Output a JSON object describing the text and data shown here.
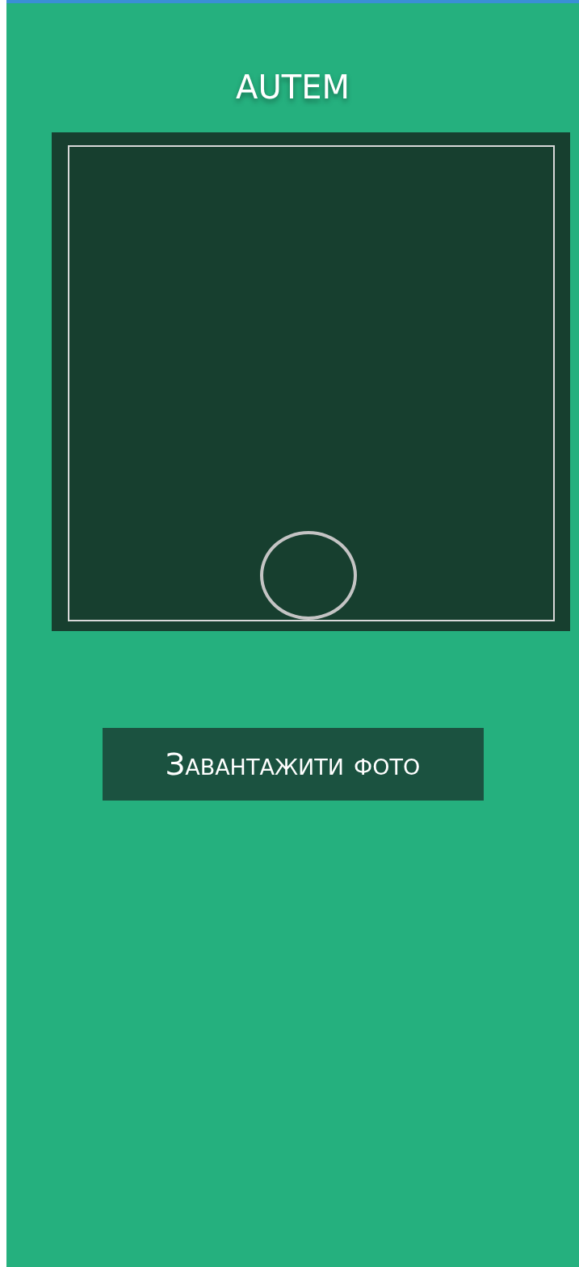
{
  "title": "AUTEM",
  "upload_button": {
    "label": "Завантажити фото"
  }
}
